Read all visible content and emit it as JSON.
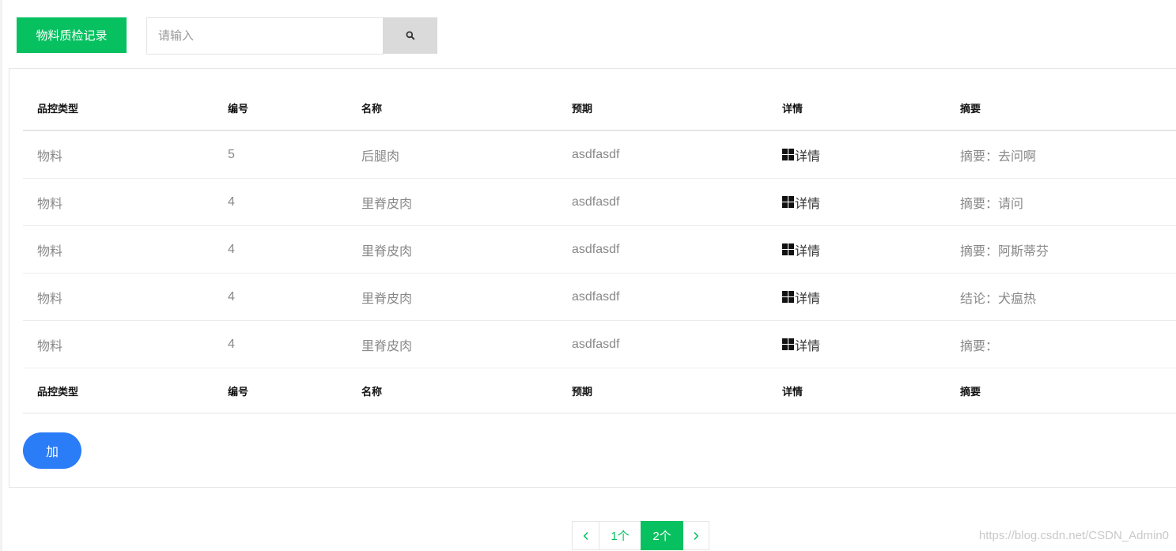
{
  "colors": {
    "primary_green": "#07c160",
    "add_button_blue": "#2b7cf7",
    "search_button_bg": "#dadada",
    "row_text": "#888888"
  },
  "header": {
    "title_button": "物料质检记录",
    "search": {
      "placeholder": "请输入",
      "value": "",
      "button_icon": "search-icon"
    }
  },
  "table": {
    "columns": [
      "品控类型",
      "编号",
      "名称",
      "预期",
      "详情",
      "摘要"
    ],
    "rows": [
      {
        "type": "物料",
        "number": "5",
        "name": "后腿肉",
        "expected": "asdfasdf",
        "detail_icon": "grid-icon",
        "detail": "详情",
        "summary": "摘要：去问啊"
      },
      {
        "type": "物料",
        "number": "4",
        "name": "里脊皮肉",
        "expected": "asdfasdf",
        "detail_icon": "grid-icon",
        "detail": "详情",
        "summary": "摘要：请问"
      },
      {
        "type": "物料",
        "number": "4",
        "name": "里脊皮肉",
        "expected": "asdfasdf",
        "detail_icon": "grid-icon",
        "detail": "详情",
        "summary": "摘要：阿斯蒂芬"
      },
      {
        "type": "物料",
        "number": "4",
        "name": "里脊皮肉",
        "expected": "asdfasdf",
        "detail_icon": "grid-icon",
        "detail": "详情",
        "summary": "结论：犬瘟热"
      },
      {
        "type": "物料",
        "number": "4",
        "name": "里脊皮肉",
        "expected": "asdfasdf",
        "detail_icon": "grid-icon",
        "detail": "详情",
        "summary": "摘要："
      }
    ],
    "footer_columns": [
      "品控类型",
      "编号",
      "名称",
      "预期",
      "详情",
      "摘要"
    ]
  },
  "add_button": "加",
  "pagination": {
    "prev_icon": "chevron-left-icon",
    "pages": [
      {
        "label": "1个",
        "active": false
      },
      {
        "label": "2个",
        "active": true
      }
    ],
    "next_icon": "chevron-right-icon"
  },
  "watermark": "https://blog.csdn.net/CSDN_Admin0"
}
